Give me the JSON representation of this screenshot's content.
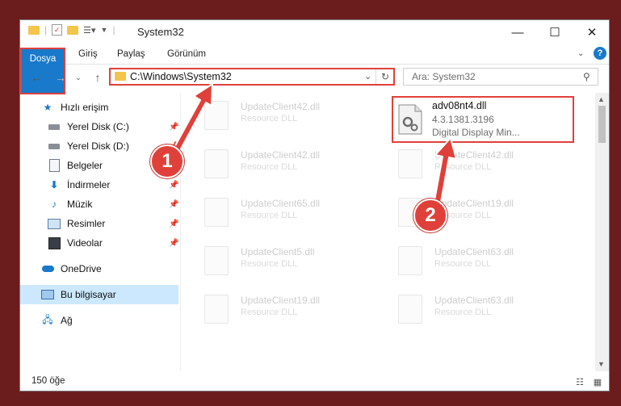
{
  "window": {
    "title": "System32",
    "controls": {
      "minimize": "—",
      "maximize": "☐",
      "close": "✕"
    }
  },
  "ribbon": {
    "tabs": [
      {
        "label": "Dosya",
        "active": true
      },
      {
        "label": "Giriş"
      },
      {
        "label": "Paylaş"
      },
      {
        "label": "Görünüm"
      }
    ],
    "help_icon": "?"
  },
  "nav": {
    "address": "C:\\Windows\\System32",
    "search_placeholder": "Ara: System32"
  },
  "sidebar": {
    "items": [
      {
        "label": "Hızlı erişim",
        "icon": "star-icon",
        "pinned": false
      },
      {
        "label": "Yerel Disk (C:)",
        "icon": "drive-icon",
        "pinned": true
      },
      {
        "label": "Yerel Disk (D:)",
        "icon": "drive-icon",
        "pinned": true
      },
      {
        "label": "Belgeler",
        "icon": "document-icon",
        "pinned": true
      },
      {
        "label": "İndirmeler",
        "icon": "download-icon",
        "pinned": true
      },
      {
        "label": "Müzik",
        "icon": "music-icon",
        "pinned": true
      },
      {
        "label": "Resimler",
        "icon": "pictures-icon",
        "pinned": true
      },
      {
        "label": "Videolar",
        "icon": "video-icon",
        "pinned": true
      },
      {
        "label": "OneDrive",
        "icon": "cloud-icon",
        "pinned": false
      },
      {
        "label": "Bu bilgisayar",
        "icon": "computer-icon",
        "pinned": false,
        "selected": true
      },
      {
        "label": "Ağ",
        "icon": "network-icon",
        "pinned": false
      }
    ]
  },
  "files": {
    "highlighted": {
      "name": "adv08nt4.dll",
      "version": "4.3.1381.3196",
      "description": "Digital Display Min..."
    },
    "background": [
      {
        "name": "UpdateClient42.dll",
        "type": "Resource DLL"
      },
      {
        "name": "UpdateClient42.dll",
        "type": "Resource DLL"
      },
      {
        "name": "UpdateClient42.dll",
        "type": "Resource DLL"
      },
      {
        "name": "UpdateClient65.dll",
        "type": "Resource DLL"
      },
      {
        "name": "UpdateClient19.dll",
        "type": "Resource DLL"
      },
      {
        "name": "UpdateClient5.dll",
        "type": "Resource DLL"
      },
      {
        "name": "UpdateClient63.dll",
        "type": "Resource DLL"
      },
      {
        "name": "UpdateClient19.dll",
        "type": "Resource DLL"
      },
      {
        "name": "UpdateClient63.dll",
        "type": "Resource DLL"
      }
    ]
  },
  "status": {
    "count": "150 öğe"
  },
  "annotations": {
    "step1": "1",
    "step2": "2",
    "color": "#e0403a"
  }
}
